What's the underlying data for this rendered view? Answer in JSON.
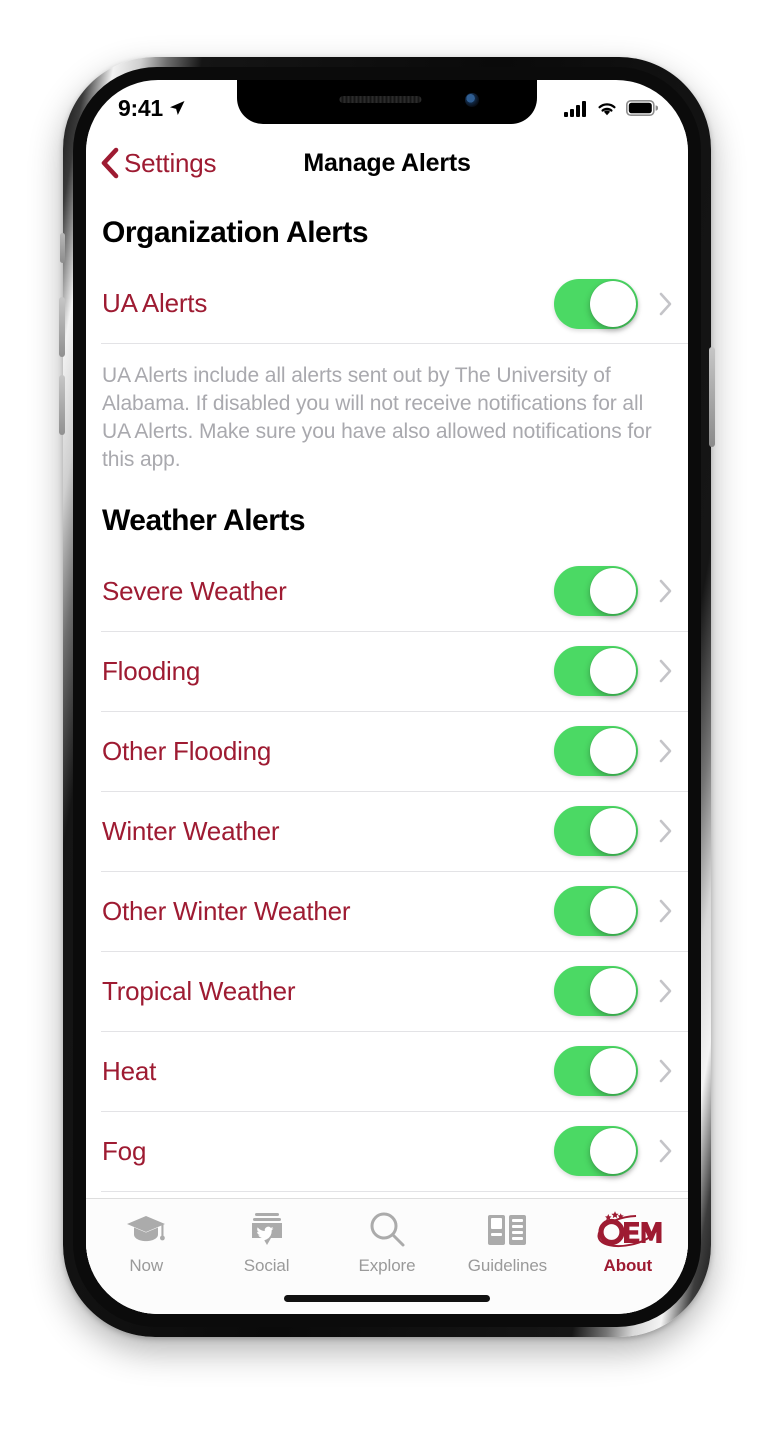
{
  "status_bar": {
    "time": "9:41",
    "location_icon": "location-arrow-icon",
    "signal_icon": "cellular-signal-icon",
    "wifi_icon": "wifi-icon",
    "battery_icon": "battery-full-icon"
  },
  "nav": {
    "back_label": "Settings",
    "back_icon": "chevron-left-icon",
    "title": "Manage Alerts"
  },
  "colors": {
    "crimson": "#9E1B32",
    "toggle_on": "#4BD964",
    "muted_text": "#a9a9ae",
    "separator": "#e3e3e6"
  },
  "sections": [
    {
      "header": "Organization Alerts",
      "rows": [
        {
          "label": "UA Alerts",
          "toggle": "on",
          "chevron": "chevron-right-icon"
        }
      ],
      "description": "UA Alerts include all alerts sent out by The University of Alabama. If disabled you will not receive notifications for all UA Alerts. Make sure you have also allowed notifications for this app."
    },
    {
      "header": "Weather Alerts",
      "rows": [
        {
          "label": "Severe Weather",
          "toggle": "on",
          "chevron": "chevron-right-icon"
        },
        {
          "label": "Flooding",
          "toggle": "on",
          "chevron": "chevron-right-icon"
        },
        {
          "label": "Other Flooding",
          "toggle": "on",
          "chevron": "chevron-right-icon"
        },
        {
          "label": "Winter Weather",
          "toggle": "on",
          "chevron": "chevron-right-icon"
        },
        {
          "label": "Other Winter Weather",
          "toggle": "on",
          "chevron": "chevron-right-icon"
        },
        {
          "label": "Tropical Weather",
          "toggle": "on",
          "chevron": "chevron-right-icon"
        },
        {
          "label": "Heat",
          "toggle": "on",
          "chevron": "chevron-right-icon"
        },
        {
          "label": "Fog",
          "toggle": "on",
          "chevron": "chevron-right-icon"
        }
      ],
      "description": ""
    }
  ],
  "tab_bar": {
    "items": [
      {
        "label": "Now",
        "icon": "graduation-cap-icon",
        "active": false
      },
      {
        "label": "Social",
        "icon": "twitter-bubble-icon",
        "active": false
      },
      {
        "label": "Explore",
        "icon": "magnifying-glass-icon",
        "active": false
      },
      {
        "label": "Guidelines",
        "icon": "two-page-book-icon",
        "active": false
      },
      {
        "label": "About",
        "icon": "oem-logo-icon",
        "active": true
      }
    ]
  },
  "oem_logo": {
    "text": "OEM"
  }
}
